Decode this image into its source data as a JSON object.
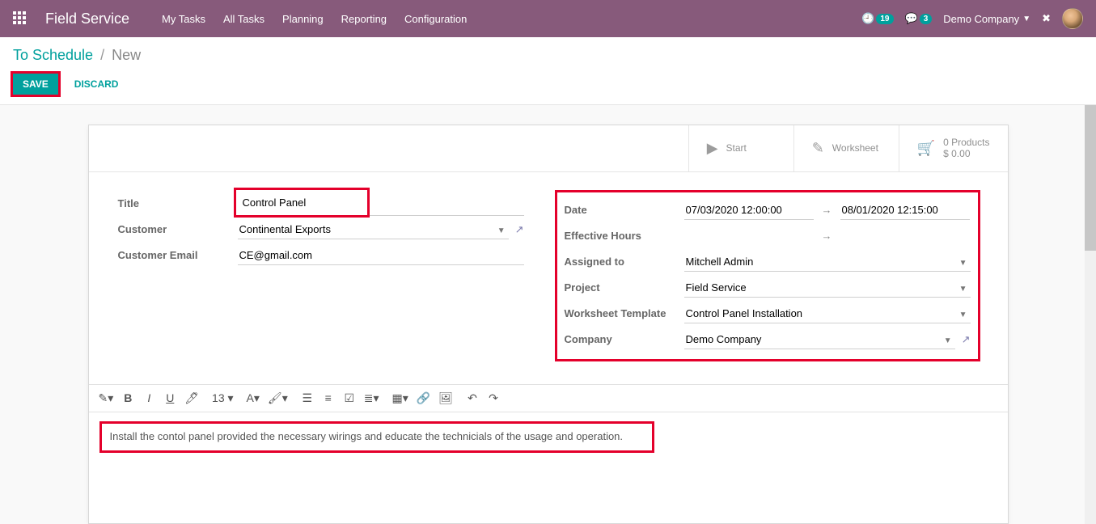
{
  "navbar": {
    "brand": "Field Service",
    "menu": [
      "My Tasks",
      "All Tasks",
      "Planning",
      "Reporting",
      "Configuration"
    ],
    "activity_count": "19",
    "messages_count": "3",
    "company": "Demo Company"
  },
  "breadcrumb": {
    "parent": "To Schedule",
    "current": "New"
  },
  "actions": {
    "save": "SAVE",
    "discard": "DISCARD"
  },
  "stat_buttons": {
    "start": "Start",
    "worksheet": "Worksheet",
    "products_title": "0 Products",
    "products_amount": "$ 0.00"
  },
  "left": {
    "title_label": "Title",
    "title_value": "Control Panel",
    "customer_label": "Customer",
    "customer_value": "Continental Exports",
    "customer_email_label": "Customer Email",
    "customer_email_value": "CE@gmail.com"
  },
  "right": {
    "date_label": "Date",
    "date_from": "07/03/2020 12:00:00",
    "date_to": "08/01/2020 12:15:00",
    "effective_hours_label": "Effective Hours",
    "assigned_label": "Assigned to",
    "assigned_value": "Mitchell Admin",
    "project_label": "Project",
    "project_value": "Field Service",
    "worksheet_tpl_label": "Worksheet Template",
    "worksheet_tpl_value": "Control Panel Installation",
    "company_label": "Company",
    "company_value": "Demo Company"
  },
  "toolbar": {
    "font_size": "13"
  },
  "editor_content": "Install the contol panel provided the necessary wirings and educate the technicials of the usage and operation."
}
